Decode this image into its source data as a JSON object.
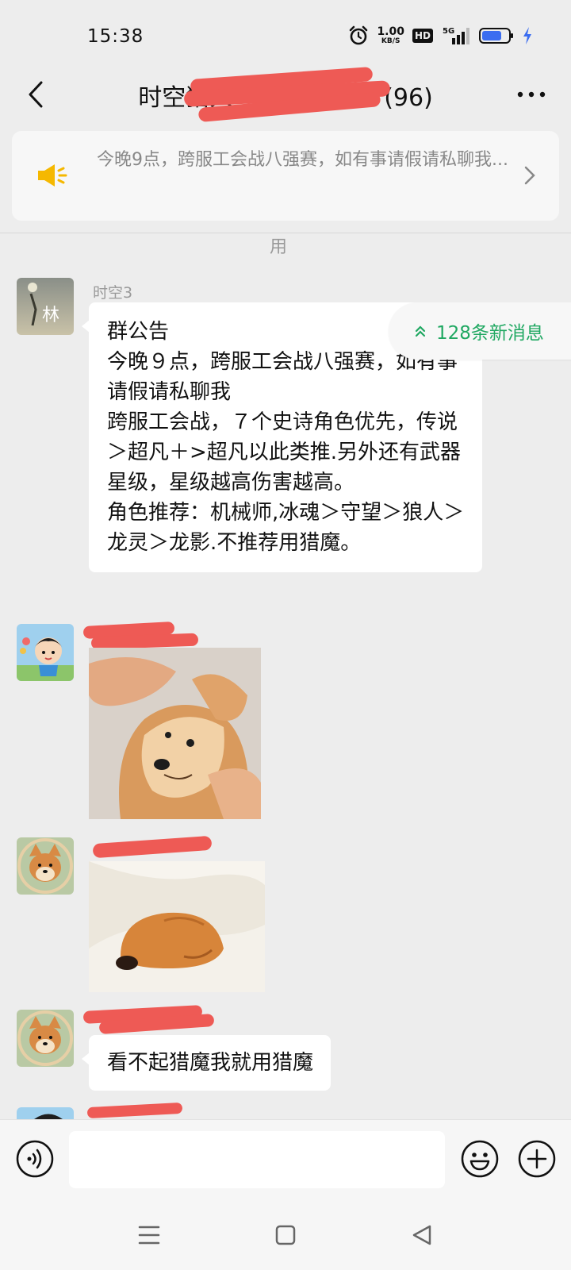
{
  "status_bar": {
    "time": "15:38",
    "speed_value": "1.00",
    "speed_unit": "KB/S",
    "hd_label": "HD",
    "network_label": "5G"
  },
  "nav": {
    "title_prefix": "时空猎人",
    "title_suffix": "(96)"
  },
  "announcement": {
    "text": "今晚9点，跨服工会战八强赛，如有事请假请私聊我..."
  },
  "partial_text": "用",
  "new_messages": {
    "label": "128条新消息",
    "color": "#20a862"
  },
  "messages": [
    {
      "sender": "时空3",
      "avatar_text": "林",
      "type": "text",
      "text": "群公告\n今晚９点，跨服工会战八强赛，如有事请假请私聊我\n跨服工会战，７个史诗角色优先，传说＞超凡＋>超凡以此类推.另外还有武器星级，星级越高伤害越高。\n角色推荐：机械师,冰魂＞守望＞狼人＞龙灵＞龙影.不推荐用猎魔。"
    },
    {
      "sender": "",
      "type": "image",
      "image": "shiba-petted-by-hands"
    },
    {
      "sender": "",
      "type": "image",
      "image": "puppy-curled-in-bed"
    },
    {
      "sender": "",
      "type": "text",
      "text": "看不起猎魔我就用猎魔"
    },
    {
      "sender": "",
      "type": "partial"
    }
  ],
  "input": {
    "placeholder": ""
  },
  "colors": {
    "background": "#ededed",
    "bubble": "#ffffff",
    "accent_green": "#20a862",
    "redaction": "#ee5a55",
    "announce_icon": "#f5b800"
  }
}
